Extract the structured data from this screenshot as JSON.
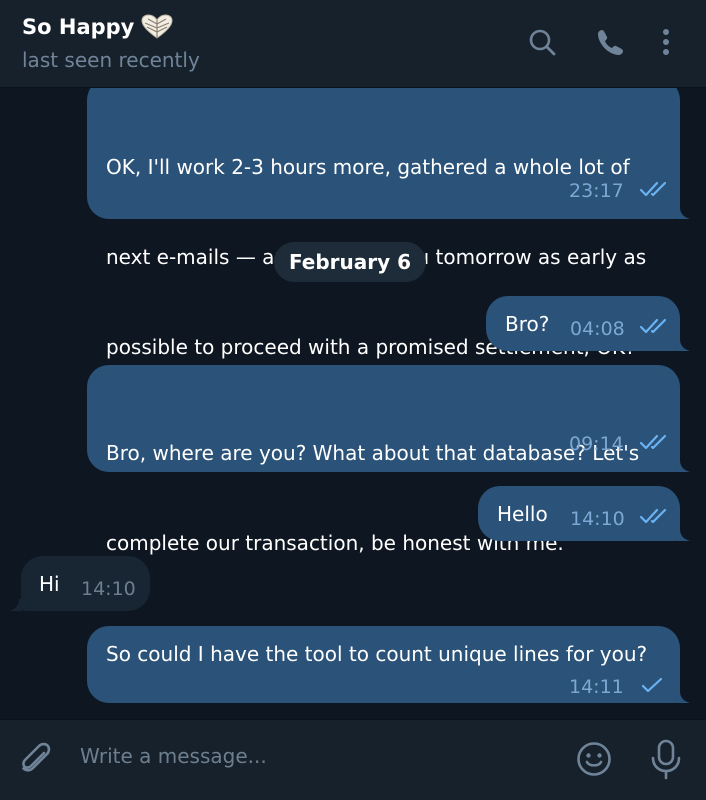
{
  "header": {
    "title": "So Happy",
    "status": "last seen recently"
  },
  "messages": [
    {
      "direction": "out",
      "lines": [
        "OK, I'll work 2-3 hours more, gathered a whole lot of",
        "next e-mails — and I expect you tomorrow as early as",
        "possible to proceed with a promised settlement, OK?"
      ],
      "time": "23:17",
      "status": "read"
    },
    {
      "direction": "out",
      "lines": [
        "Bro?"
      ],
      "time": "04:08",
      "status": "read"
    },
    {
      "direction": "out",
      "lines": [
        "Bro, where are you? What about that database? Let's",
        "complete our transaction, be honest with me."
      ],
      "time": "09:14",
      "status": "read"
    },
    {
      "direction": "out",
      "lines": [
        "Hello"
      ],
      "time": "14:10",
      "status": "read"
    },
    {
      "direction": "in",
      "lines": [
        "Hi"
      ],
      "time": "14:10"
    },
    {
      "direction": "out",
      "lines": [
        "So could I have the tool to count unique lines for you?"
      ],
      "time": "14:11",
      "status": "sent"
    }
  ],
  "date_separator": "February 6",
  "composer": {
    "placeholder": "Write a message..."
  },
  "colors": {
    "background": "#0e1621",
    "header": "#17212b",
    "outgoing_bubble": "#2b5278",
    "incoming_bubble": "#182533",
    "meta_text": "#7da8d3",
    "secondary_text": "#708499"
  },
  "icons": [
    "heart-icon",
    "search-icon",
    "phone-icon",
    "more-icon",
    "attach-icon",
    "emoji-icon",
    "microphone-icon",
    "double-check-icon",
    "single-check-icon"
  ]
}
